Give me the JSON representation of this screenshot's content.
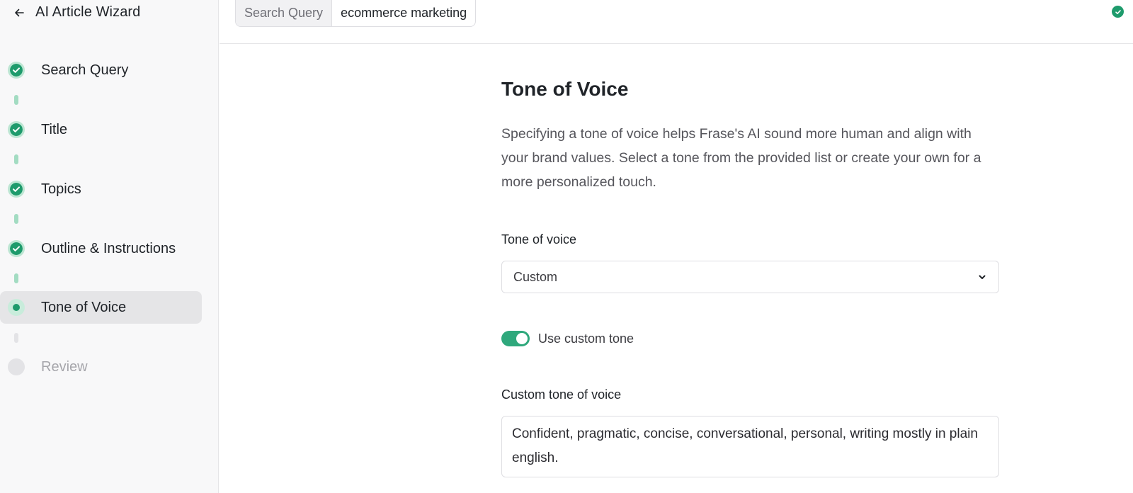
{
  "sidebar": {
    "title": "AI Article Wizard",
    "back_icon": "arrow-left-icon",
    "steps": [
      {
        "label": "Search Query",
        "status": "done"
      },
      {
        "label": "Title",
        "status": "done"
      },
      {
        "label": "Topics",
        "status": "done"
      },
      {
        "label": "Outline & Instructions",
        "status": "done"
      },
      {
        "label": "Tone of Voice",
        "status": "current"
      },
      {
        "label": "Review",
        "status": "pending"
      }
    ]
  },
  "topbar": {
    "query_label": "Search Query",
    "query_value": "ecommerce marketing",
    "status_icon": "check-circle-icon"
  },
  "main": {
    "title": "Tone of Voice",
    "description": "Specifying a tone of voice helps Frase's AI sound more human and align with your brand values. Select a tone from the provided list or create your own for a more personalized touch.",
    "tone_label": "Tone of voice",
    "tone_selected": "Custom",
    "custom_toggle_label": "Use custom tone",
    "custom_toggle_on": true,
    "custom_tone_label": "Custom tone of voice",
    "custom_tone_value": "Confident, pragmatic, concise, conversational, personal, writing mostly in plain english."
  },
  "colors": {
    "accent": "#1e9b6c",
    "accent_light": "#a3dcc2",
    "sidebar_bg": "#f8f8f9",
    "active_step_bg": "#e5e5e7"
  }
}
